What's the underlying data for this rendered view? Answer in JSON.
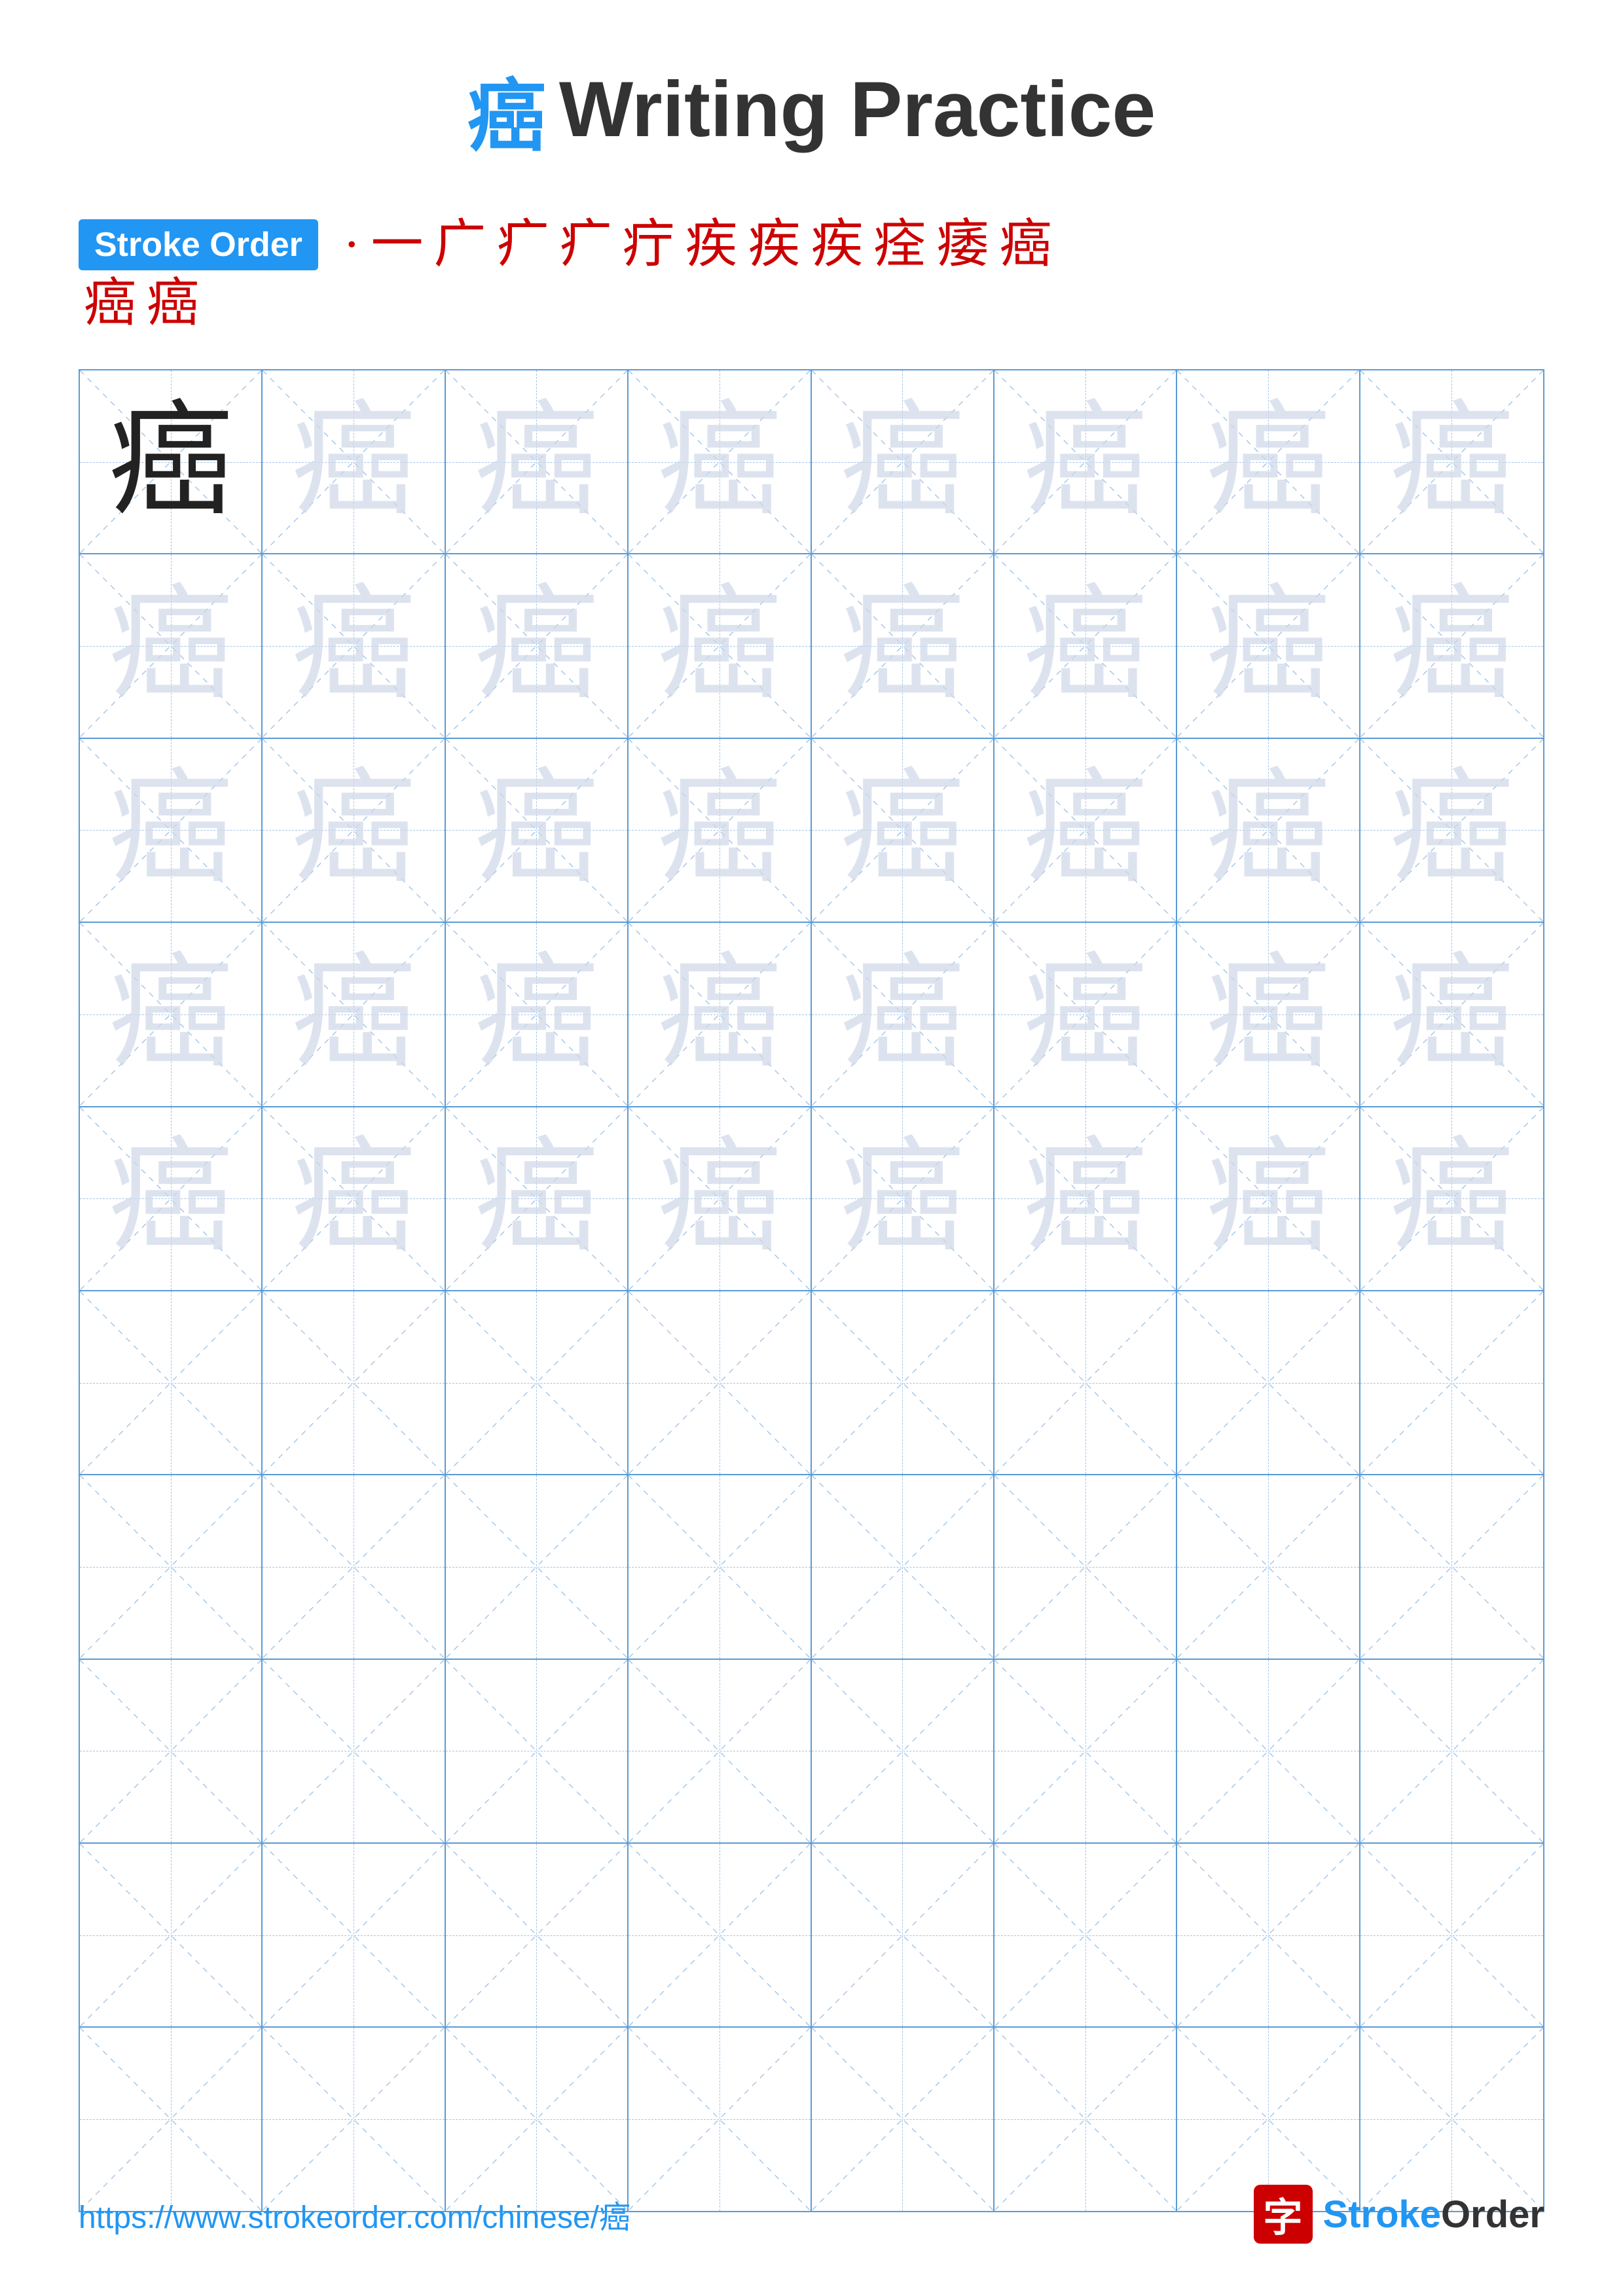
{
  "page": {
    "title_char": "癌",
    "title_text": "Writing Practice",
    "stroke_order_label": "Stroke Order",
    "stroke_sequence_line1": [
      "·",
      "¯",
      "广",
      "广",
      "广",
      "疒",
      "疾",
      "疾",
      "疾",
      "痊",
      "痿",
      "癌"
    ],
    "stroke_sequence_line2": [
      "癌",
      "癌"
    ],
    "practice_char": "癌",
    "grid_rows": 10,
    "grid_cols": 8,
    "filled_rows": 5,
    "footer_url": "https://www.strokeorder.com/chinese/癌",
    "footer_logo_char": "字",
    "footer_brand": "StrokeOrder"
  }
}
